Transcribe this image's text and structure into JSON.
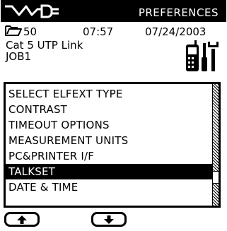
{
  "header": {
    "logo_icon": "waveform-plug-icon",
    "title": "PREFERENCES"
  },
  "status": {
    "folder_icon": "folder-icon",
    "folder_count": "50",
    "time": "07:57",
    "date": "07/24/2003"
  },
  "job": {
    "link_type": "Cat 5 UTP Link",
    "name": "JOB1",
    "tool_icon": "handset-tools-icon"
  },
  "menu": {
    "items": [
      "SELECT ELFEXT TYPE",
      "CONTRAST",
      "TIMEOUT OPTIONS",
      "MEASUREMENT UNITS",
      "PC&PRINTER I/F",
      "TALKSET",
      "DATE & TIME"
    ],
    "selected_index": 5,
    "scroll_fraction": 0.8
  },
  "softkeys": {
    "up_icon": "arrow-up-icon",
    "down_icon": "arrow-down-icon"
  },
  "colors": {
    "foreground": "#000000",
    "background": "#ffffff"
  }
}
